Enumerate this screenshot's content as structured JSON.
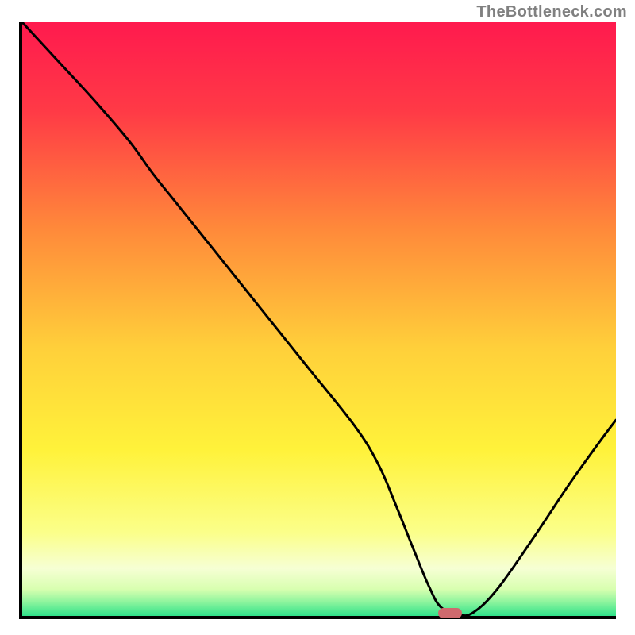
{
  "watermark": "TheBottleneck.com",
  "chart_data": {
    "type": "line",
    "title": "",
    "xlabel": "",
    "ylabel": "",
    "xlim": [
      0,
      100
    ],
    "ylim": [
      0,
      100
    ],
    "background_gradient": {
      "stops": [
        {
          "pos": 0.0,
          "color": "#ff1a4e"
        },
        {
          "pos": 0.15,
          "color": "#ff3a46"
        },
        {
          "pos": 0.35,
          "color": "#ff8a3a"
        },
        {
          "pos": 0.55,
          "color": "#ffd03a"
        },
        {
          "pos": 0.72,
          "color": "#fff23a"
        },
        {
          "pos": 0.86,
          "color": "#fbff8a"
        },
        {
          "pos": 0.92,
          "color": "#f6ffd4"
        },
        {
          "pos": 0.955,
          "color": "#d8ffb0"
        },
        {
          "pos": 0.975,
          "color": "#93f59f"
        },
        {
          "pos": 1.0,
          "color": "#2fe28a"
        }
      ]
    },
    "series": [
      {
        "name": "bottleneck-curve",
        "x": [
          0.0,
          6.0,
          12.0,
          18.0,
          22.0,
          26.0,
          32.0,
          40.0,
          48.0,
          56.0,
          60.0,
          63.0,
          66.0,
          68.5,
          70.5,
          73.5,
          76.0,
          80.0,
          86.0,
          92.0,
          97.0,
          100.0
        ],
        "y": [
          100.0,
          93.5,
          87.0,
          80.0,
          74.5,
          69.5,
          62.0,
          52.0,
          42.0,
          32.0,
          25.5,
          18.5,
          11.0,
          5.0,
          1.5,
          0.2,
          0.6,
          4.5,
          13.0,
          22.0,
          29.0,
          33.0
        ]
      }
    ],
    "marker": {
      "x": 72.0,
      "y": 0.0,
      "color": "#cf6a6e"
    }
  }
}
